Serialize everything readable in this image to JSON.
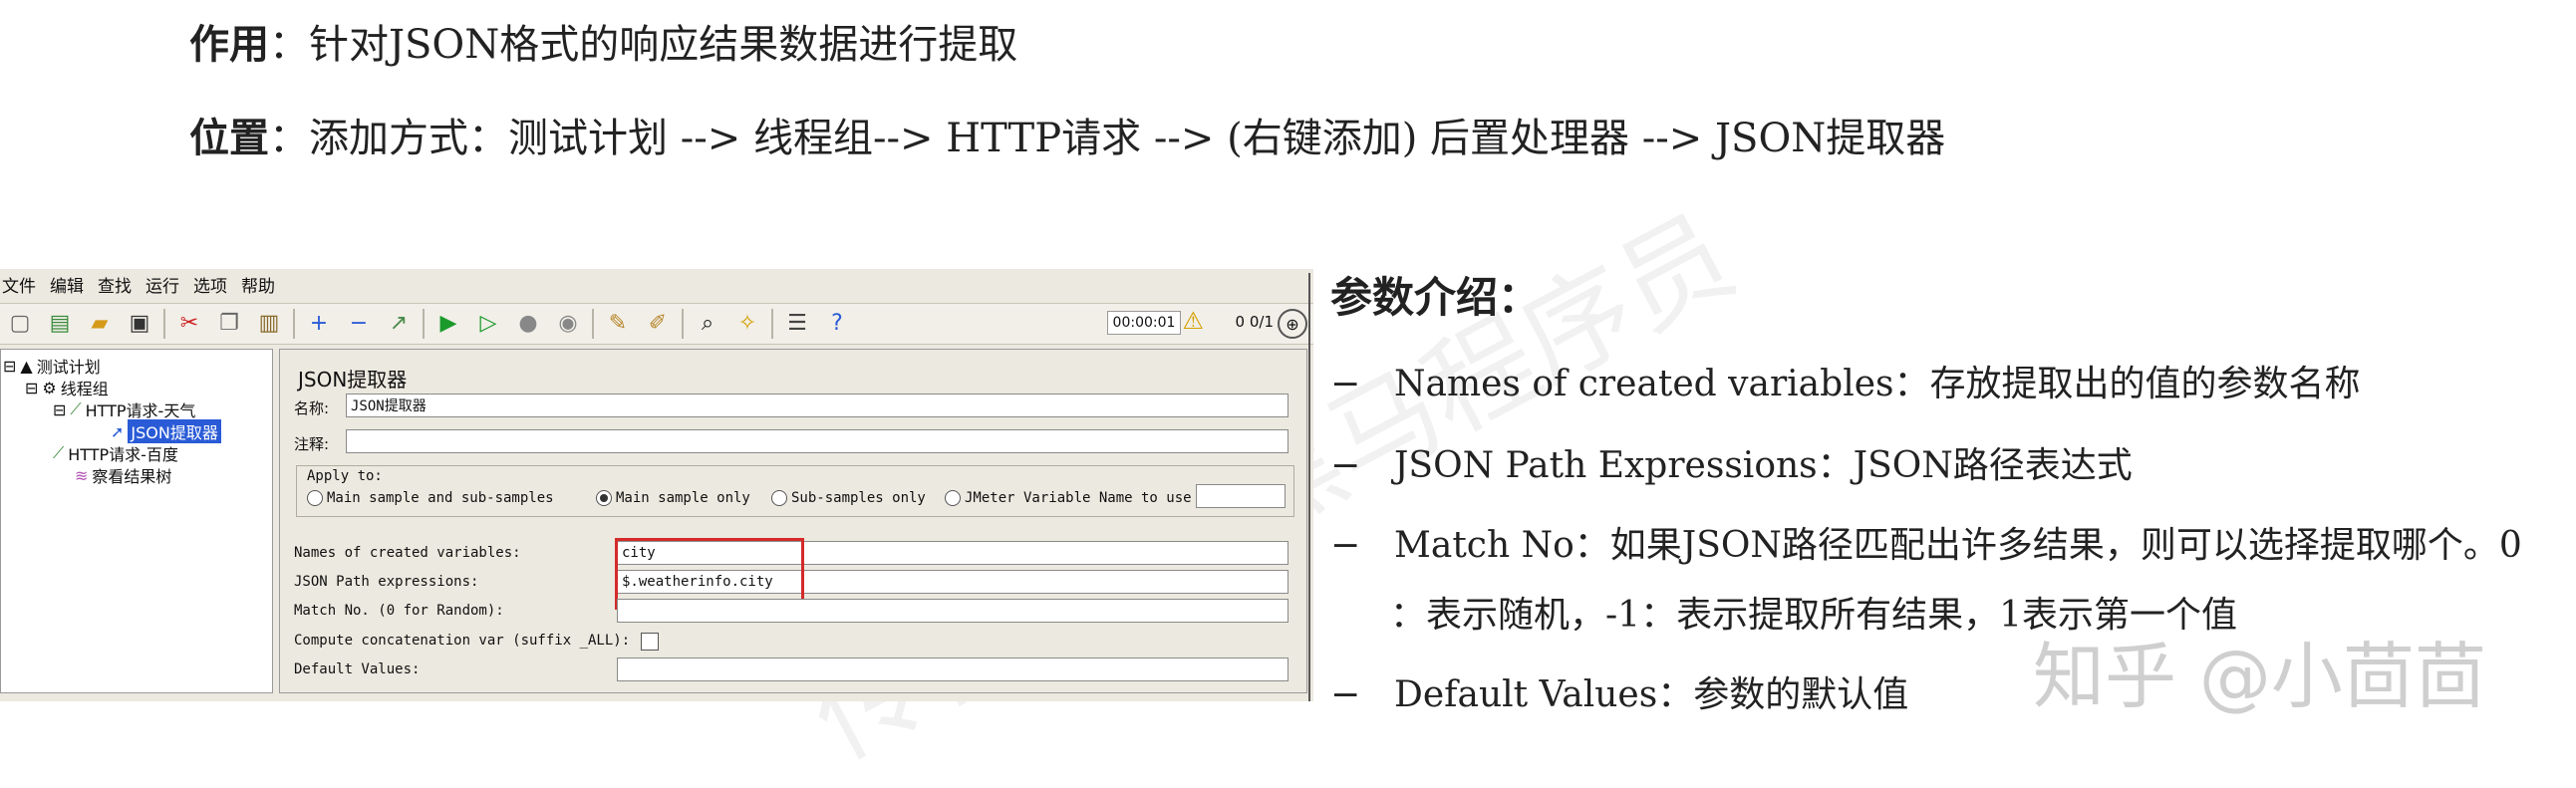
{
  "doc": {
    "line1_label": "作用",
    "line1_text": "：针对JSON格式的响应结果数据进行提取",
    "line2_label": "位置",
    "line2_text": "：添加方式：测试计划 --> 线程组--> HTTP请求 --> (右键添加) 后置处理器 --> JSON提取器"
  },
  "jmeter": {
    "menu": [
      "文件",
      "编辑",
      "查找",
      "运行",
      "选项",
      "帮助"
    ],
    "timer": "00:00:01",
    "warn_count": "0",
    "threads": "0/1",
    "tree": {
      "root": "测试计划",
      "group": "线程组",
      "http1": "HTTP请求-天气",
      "extractor": "JSON提取器",
      "http2": "HTTP请求-百度",
      "results": "察看结果树"
    },
    "panel": {
      "title": "JSON提取器",
      "name_label": "名称:",
      "name_value": "JSON提取器",
      "comment_label": "注释:",
      "apply_to": "Apply to:",
      "radios": [
        "Main sample and sub-samples",
        "Main sample only",
        "Sub-samples only",
        "JMeter Variable Name to use"
      ],
      "selected_radio": 1,
      "vars_label": "Names of created variables:",
      "vars_value": "city",
      "path_label": "JSON Path expressions:",
      "path_value": "$.weatherinfo.city",
      "match_label": "Match No. (0 for Random):",
      "concat_label": "Compute concatenation var (suffix _ALL):",
      "default_label": "Default Values:"
    }
  },
  "params": {
    "title": "参数介绍：",
    "items": [
      {
        "term": "Names of created variables",
        "desc": "：存放提取出的值的参数名称"
      },
      {
        "term": "JSON Path Expressions",
        "desc": "：JSON路径表达式"
      },
      {
        "term": "Match No",
        "desc": "：如果JSON路径匹配出许多结果，则可以选择提取哪个。0"
      },
      {
        "term": "Default Values",
        "desc": "：参数的默认值"
      }
    ],
    "match_cont": "：表示随机，-1：表示提取所有结果，1表示第一个值"
  },
  "watermark": "知乎 @小茴茴",
  "bg_watermark": "传智教育·黑马程序员",
  "colors": {
    "highlight": "#d42a2a",
    "selection": "#2a5bd7"
  }
}
